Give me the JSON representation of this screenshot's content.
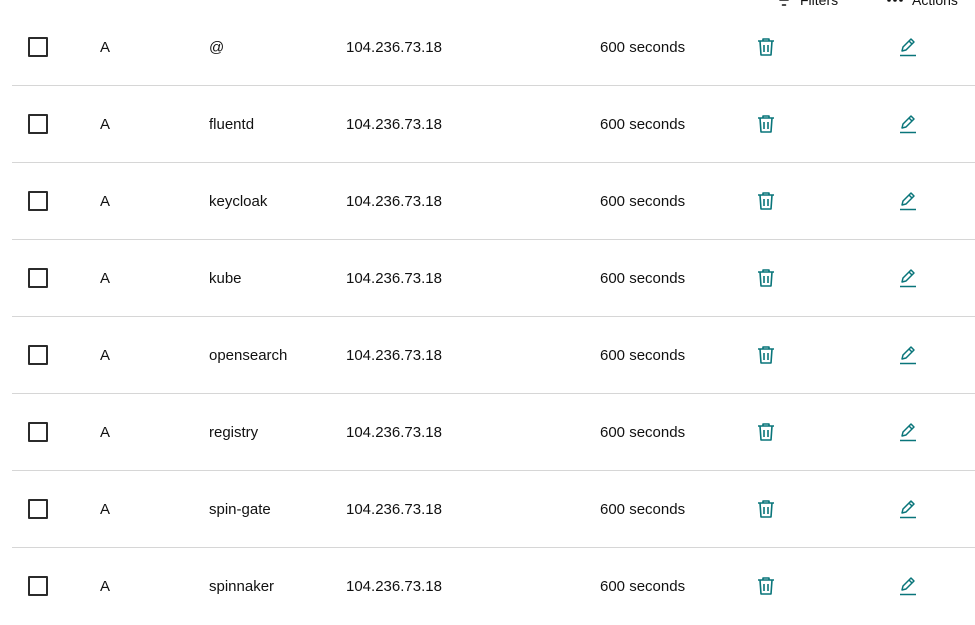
{
  "toolbar": {
    "filters_label": "Filters",
    "actions_label": "Actions"
  },
  "colors": {
    "accent": "#09757a",
    "text": "#111111",
    "divider": "#d6d6d6"
  },
  "icons": {
    "delete": "trash-icon",
    "edit": "pencil-icon",
    "filters": "filter-icon",
    "actions": "more-horizontal-icon"
  },
  "records": [
    {
      "type": "A",
      "name": "@",
      "value": "104.236.73.18",
      "ttl": "600 seconds"
    },
    {
      "type": "A",
      "name": "fluentd",
      "value": "104.236.73.18",
      "ttl": "600 seconds"
    },
    {
      "type": "A",
      "name": "keycloak",
      "value": "104.236.73.18",
      "ttl": "600 seconds"
    },
    {
      "type": "A",
      "name": "kube",
      "value": "104.236.73.18",
      "ttl": "600 seconds"
    },
    {
      "type": "A",
      "name": "opensearch",
      "value": "104.236.73.18",
      "ttl": "600 seconds"
    },
    {
      "type": "A",
      "name": "registry",
      "value": "104.236.73.18",
      "ttl": "600 seconds"
    },
    {
      "type": "A",
      "name": "spin-gate",
      "value": "104.236.73.18",
      "ttl": "600 seconds"
    },
    {
      "type": "A",
      "name": "spinnaker",
      "value": "104.236.73.18",
      "ttl": "600 seconds"
    }
  ]
}
